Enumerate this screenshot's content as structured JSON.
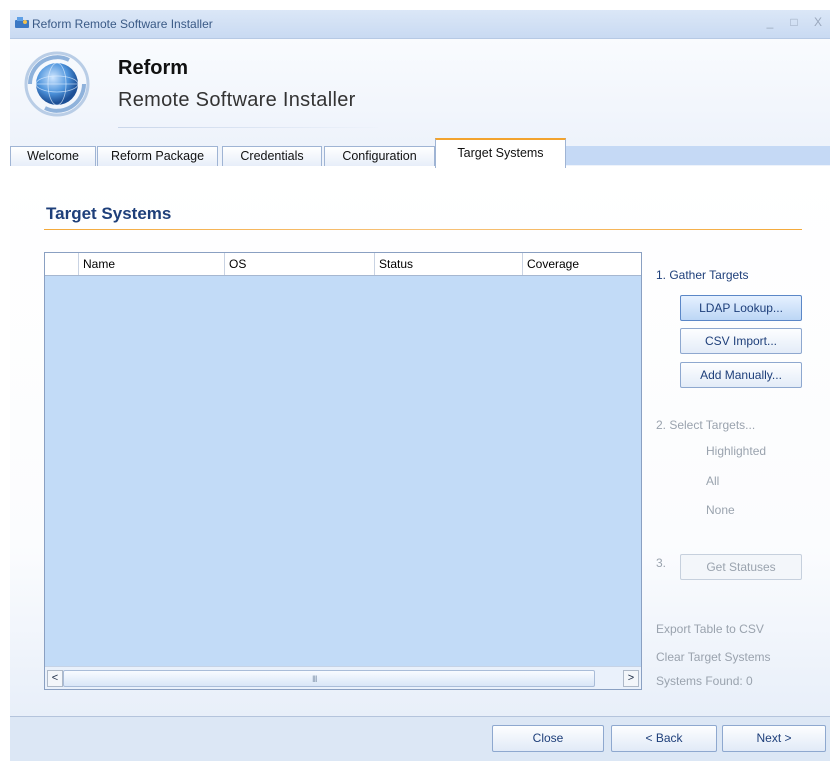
{
  "window": {
    "title": "Reform Remote Software Installer",
    "controls": [
      "_",
      "□",
      "X"
    ]
  },
  "header": {
    "brand_name": "Reform",
    "brand_subtitle": "Remote Software Installer"
  },
  "tabs": [
    "Welcome",
    "Reform Package",
    "Credentials",
    "Configuration",
    "Target Systems"
  ],
  "active_tab": "Target Systems",
  "page": {
    "title": "Target Systems"
  },
  "grid": {
    "columns": [
      "",
      "Name",
      "OS",
      "Status",
      "Coverage"
    ],
    "rows": []
  },
  "scroll": {
    "left": "<",
    "right": ">",
    "grip": "III"
  },
  "actions": {
    "step1": "1.  Gather Targets",
    "ldap": "LDAP Lookup...",
    "csv": "CSV Import...",
    "manual": "Add Manually...",
    "step2": "2.   Select Targets...",
    "highlighted": "Highlighted",
    "all": "All",
    "none": "None",
    "step3": "3.",
    "get_statuses": "Get Statuses",
    "export": "Export Table to CSV",
    "clear": "Clear Target Systems",
    "systems_found": "Systems Found: 0"
  },
  "footer": {
    "close": "Close",
    "back": "< Back",
    "next": "Next >"
  },
  "colors": {
    "accent": "#f2a32e",
    "title_blue": "#1e3f7a",
    "grid_bg": "#c2dbf7",
    "disabled": "#9aa3ae"
  }
}
